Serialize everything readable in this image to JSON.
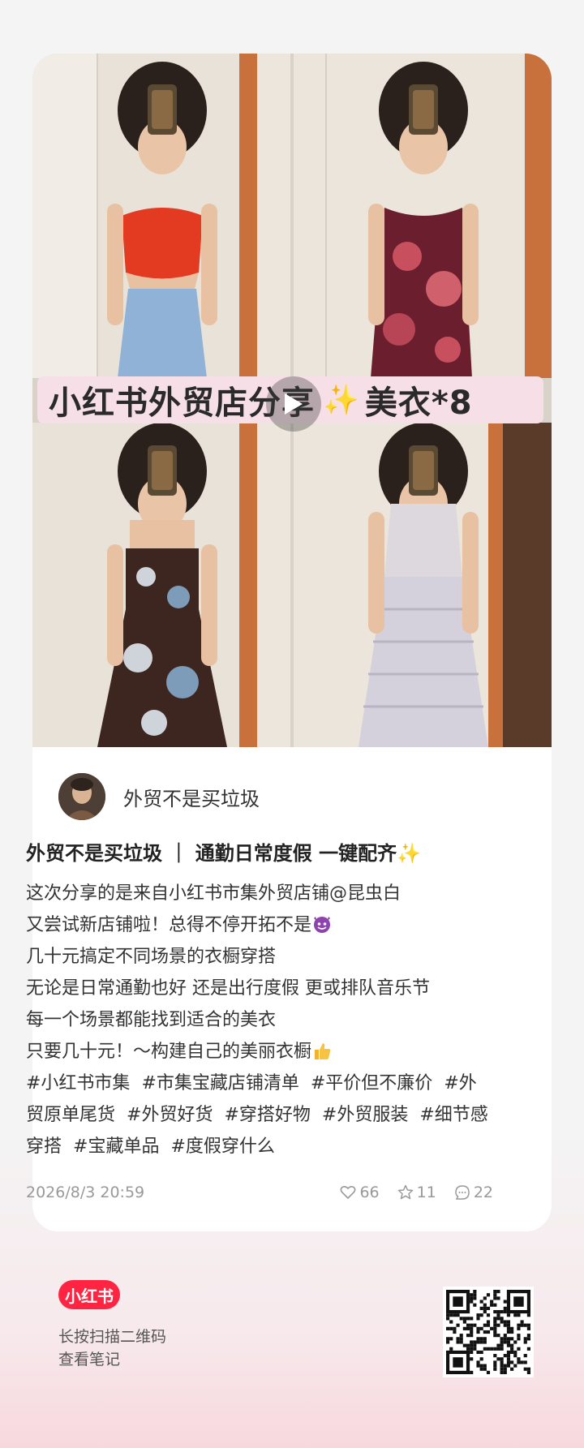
{
  "cover": {
    "title": "小红书外贸店分享",
    "title_suffix": "美衣*8"
  },
  "author": {
    "name": "外贸不是买垃圾"
  },
  "post": {
    "title": "外贸不是买垃圾 ｜ 通勤日常度假 一键配齐✨",
    "lines": [
      "这次分享的是来自小红书市集外贸店铺@昆虫白",
      "又尝试新店铺啦！总得不停开拓不是",
      "几十元搞定不同场景的衣橱穿搭",
      "无论是日常通勤也好 还是出行度假 更或排队音乐节",
      "每一个场景都能找到适合的美衣",
      "只要几十元！～构建自己的美丽衣橱"
    ],
    "tags": [
      "#小红书市集",
      "#市集宝藏店铺清单",
      "#平价但不廉价",
      "#外贸原单尾货",
      "#外贸好货",
      "#穿搭好物",
      "#外贸服装",
      "#细节感穿搭",
      "#宝藏单品",
      "#度假穿什么"
    ],
    "date": "2026/8/3 20:59",
    "likes": "66",
    "collects": "11",
    "comments": "22"
  },
  "footer": {
    "brand": "小红书",
    "scan_line1": "长按扫描二维码",
    "scan_line2": "查看笔记"
  },
  "colors": {
    "brand": "#ff2442",
    "banner": "#f6dfe6",
    "sparkle": "#f2b230"
  },
  "icons": [
    "play-icon",
    "heart-icon",
    "star-icon",
    "comment-icon",
    "devil-emoji-icon",
    "thumbs-up-emoji-icon",
    "qr-code"
  ]
}
